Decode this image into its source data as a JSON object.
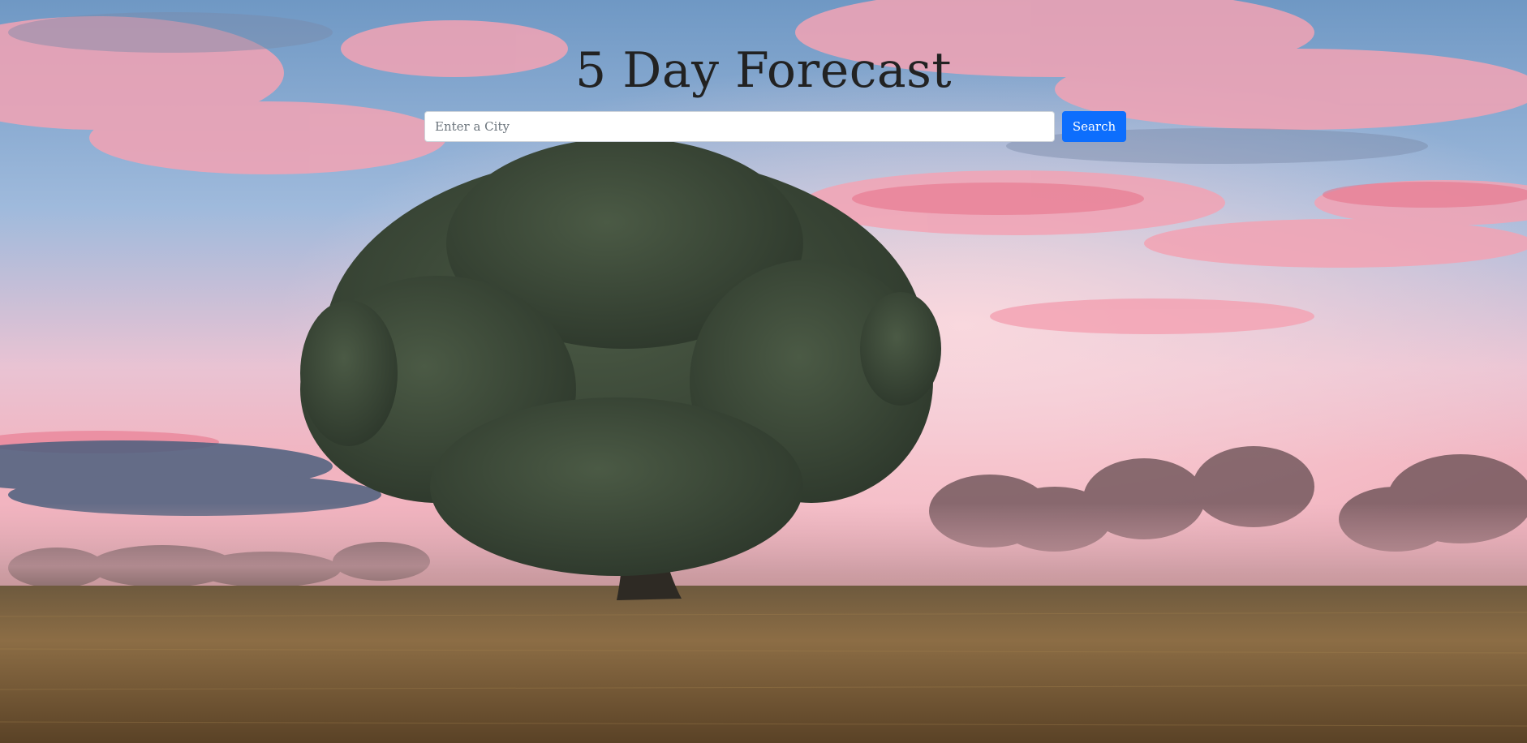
{
  "header": {
    "title": "5 Day Forecast"
  },
  "search": {
    "placeholder": "Enter a City",
    "value": "",
    "button_label": "Search"
  },
  "colors": {
    "title_text": "#222222",
    "button_bg": "#0d6efd",
    "button_text": "#ffffff",
    "input_bg": "#ffffff"
  },
  "background": {
    "description_icon": "landscape-photo"
  }
}
